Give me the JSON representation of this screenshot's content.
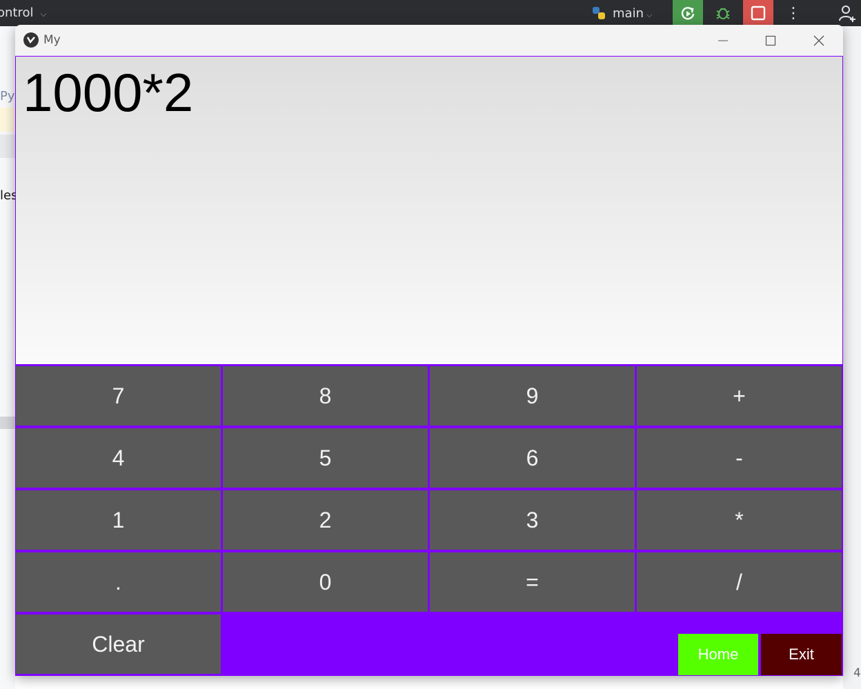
{
  "ide": {
    "control_label": "ontrol",
    "branch_label": "main",
    "left_text_1": "Py",
    "left_text_2": "les",
    "right_text": "4"
  },
  "window": {
    "title": "My",
    "icons": {
      "app": "kivy-logo-icon",
      "minimize": "minimize-icon",
      "maximize": "maximize-icon",
      "close": "close-icon"
    }
  },
  "calculator": {
    "display_value": "1000*2",
    "keys": [
      [
        "7",
        "8",
        "9",
        "+"
      ],
      [
        "4",
        "5",
        "6",
        "-"
      ],
      [
        "1",
        "2",
        "3",
        "*"
      ],
      [
        ".",
        "0",
        "=",
        "/"
      ]
    ],
    "clear_label": "Clear",
    "home_label": "Home",
    "exit_label": "Exit"
  },
  "colors": {
    "key_background": "#595959",
    "grid_background": "#7f00ff",
    "home_button": "#55ff00",
    "exit_button": "#550000"
  }
}
